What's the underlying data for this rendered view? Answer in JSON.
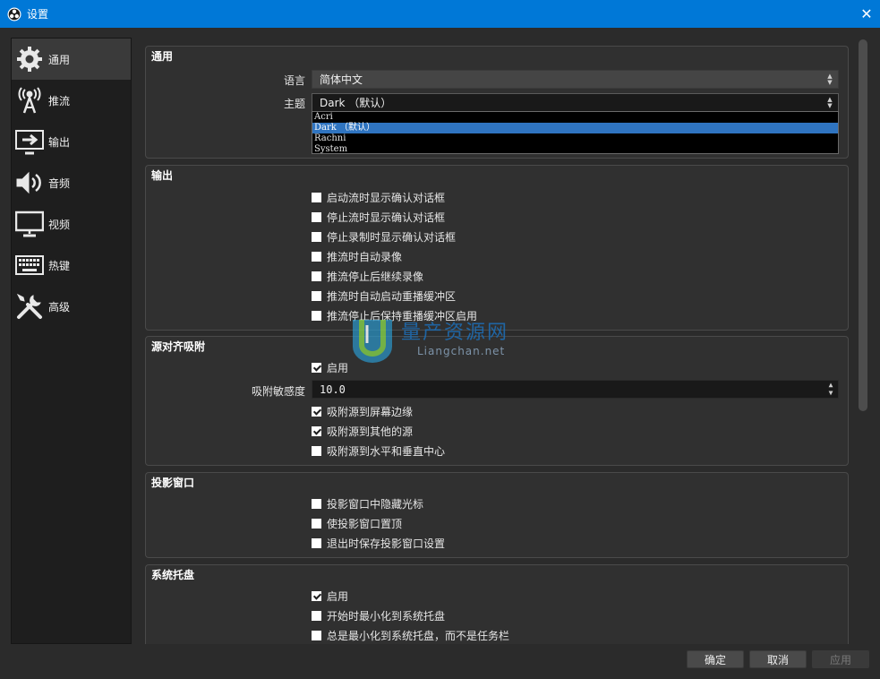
{
  "window": {
    "title": "设置",
    "close_glyph": "✕"
  },
  "sidebar": {
    "items": [
      {
        "label": "通用",
        "icon": "gear-icon",
        "active": true
      },
      {
        "label": "推流",
        "icon": "broadcast-icon",
        "active": false
      },
      {
        "label": "输出",
        "icon": "output-icon",
        "active": false
      },
      {
        "label": "音频",
        "icon": "speaker-icon",
        "active": false
      },
      {
        "label": "视频",
        "icon": "monitor-icon",
        "active": false
      },
      {
        "label": "热键",
        "icon": "keyboard-icon",
        "active": false
      },
      {
        "label": "高级",
        "icon": "tools-icon",
        "active": false
      }
    ]
  },
  "general": {
    "title": "通用",
    "language_label": "语言",
    "language_value": "简体中文",
    "theme_label": "主题",
    "theme_value": "Dark （默认）",
    "theme_options": [
      "Acri",
      "Dark （默认）",
      "Rachni",
      "System"
    ],
    "theme_selected_index": 1
  },
  "output": {
    "title": "输出",
    "checks": [
      {
        "label": "启动流时显示确认对话框",
        "checked": false
      },
      {
        "label": "停止流时显示确认对话框",
        "checked": false
      },
      {
        "label": "停止录制时显示确认对话框",
        "checked": false
      },
      {
        "label": "推流时自动录像",
        "checked": false
      },
      {
        "label": "推流停止后继续录像",
        "checked": false
      },
      {
        "label": "推流时自动启动重播缓冲区",
        "checked": false
      },
      {
        "label": "推流停止后保持重播缓冲区启用",
        "checked": false
      }
    ]
  },
  "snapping": {
    "title": "源对齐吸附",
    "enable_label": "启用",
    "enable_checked": true,
    "sensitivity_label": "吸附敏感度",
    "sensitivity_value": "10.0",
    "checks": [
      {
        "label": "吸附源到屏幕边缘",
        "checked": true
      },
      {
        "label": "吸附源到其他的源",
        "checked": true
      },
      {
        "label": "吸附源到水平和垂直中心",
        "checked": false
      }
    ]
  },
  "projector": {
    "title": "投影窗口",
    "checks": [
      {
        "label": "投影窗口中隐藏光标",
        "checked": false
      },
      {
        "label": "使投影窗口置顶",
        "checked": false
      },
      {
        "label": "退出时保存投影窗口设置",
        "checked": false
      }
    ]
  },
  "tray": {
    "title": "系统托盘",
    "checks": [
      {
        "label": "启用",
        "checked": true
      },
      {
        "label": "开始时最小化到系统托盘",
        "checked": false
      },
      {
        "label": "总是最小化到系统托盘，而不是任务栏",
        "checked": false
      }
    ]
  },
  "buttons": {
    "ok": "确定",
    "cancel": "取消",
    "apply": "应用"
  },
  "watermark": {
    "cn": "量产资源网",
    "en": "Liangchan.net"
  },
  "colors": {
    "titlebar": "#0078d7",
    "selection": "#2f74c0",
    "panel": "#303030",
    "sidebar": "#1e1e1e"
  }
}
